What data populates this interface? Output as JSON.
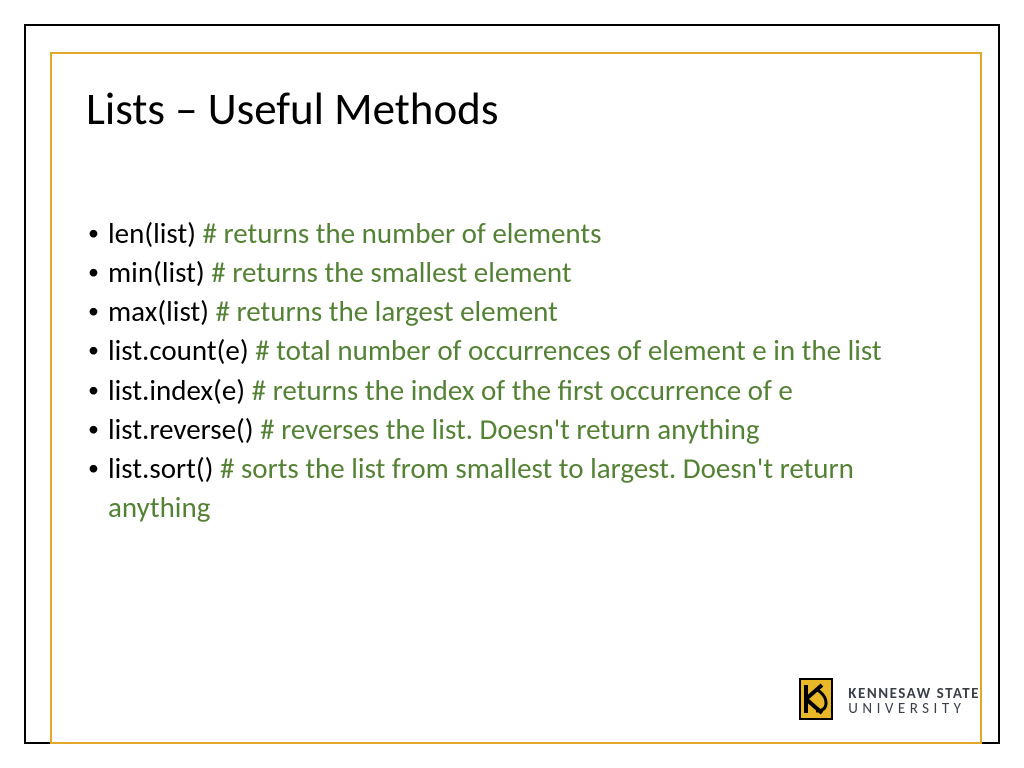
{
  "title": "Lists – Useful Methods",
  "items": [
    {
      "method": "len(list) ",
      "comment": "# returns the number of elements"
    },
    {
      "method": "min(list) ",
      "comment": "# returns the smallest element"
    },
    {
      "method": "max(list) ",
      "comment": "# returns the largest element"
    },
    {
      "method": "list.count(e) ",
      "comment": "# total number of occurrences of element e in the list"
    },
    {
      "method": "list.index(e) ",
      "comment": "# returns the index of the first occurrence of e"
    },
    {
      "method": "list.reverse() ",
      "comment": "# reverses the list. Doesn't return anything"
    },
    {
      "method": "list.sort() ",
      "comment": "# sorts the list from smallest to largest. Doesn't return anything"
    }
  ],
  "logo": {
    "line1": "KENNESAW STATE",
    "line2": "UNIVERSITY"
  }
}
